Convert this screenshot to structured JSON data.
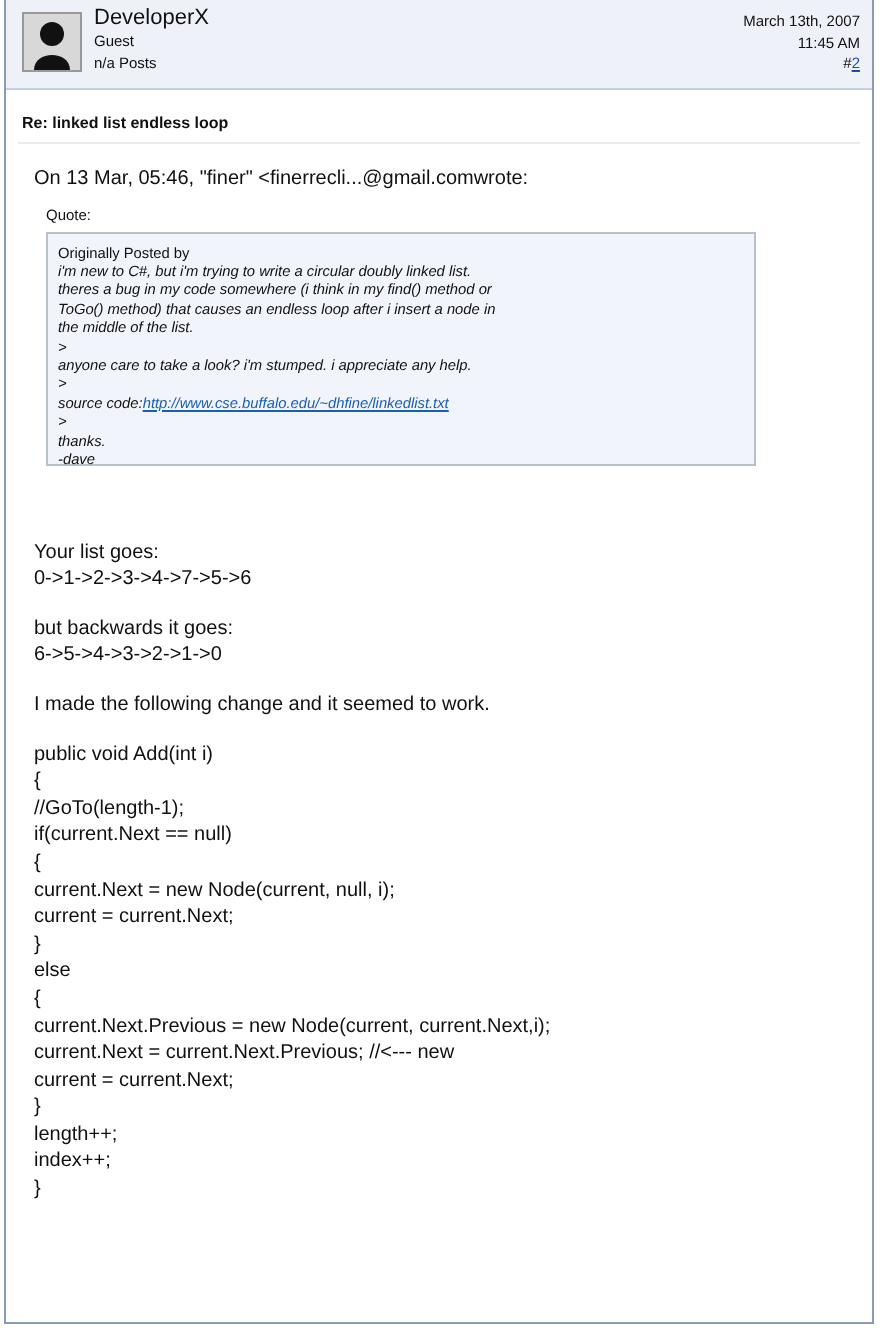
{
  "author": {
    "name": "DeveloperX",
    "rank": "Guest",
    "posts": "n/a Posts"
  },
  "post_date": "March 13th, 2007",
  "post_time": "11:45 AM",
  "post_number": {
    "hash": "#",
    "number": "2"
  },
  "title": "Re: linked list endless loop",
  "intro": "On 13 Mar, 05:46, \"finer\" <finerrecli...@gmail.comwrote:",
  "quote": {
    "label": "Quote:",
    "header": "Originally Posted by",
    "lines": [
      {
        "text": "i'm new to C#, but i'm trying to write a circular doubly linked list."
      },
      {
        "text": "theres a bug in my code somewhere (i think in my find() method or"
      },
      {
        "text": "ToGo() method) that causes an endless loop after i insert a node in"
      },
      {
        "text": "the middle of the list."
      },
      {
        "text": ">"
      },
      {
        "text": "anyone care to take a look? i'm stumped. i appreciate any help."
      },
      {
        "text": ">"
      },
      {
        "text": "source code:",
        "link": "http://www.cse.buffalo.edu/~dhfine/linkedlist.txt"
      },
      {
        "text": ">"
      },
      {
        "text": "thanks."
      },
      {
        "text": "-dave"
      }
    ]
  },
  "paragraphs": [
    [
      "Your list goes:",
      "0->1->2->3->4->7->5->6"
    ],
    [
      "but backwards it goes:",
      "6->5->4->3->2->1->0"
    ],
    [
      "I made the following change and it seemed to work."
    ],
    [
      "public void Add(int i)",
      "{",
      "//GoTo(length-1);",
      "if(current.Next == null)",
      "{",
      "current.Next = new Node(current, null, i);",
      "current = current.Next;",
      "}",
      "else",
      "{",
      "current.Next.Previous = new Node(current, current.Next,i);",
      "current.Next = current.Next.Previous; //<--- new",
      "current = current.Next;",
      "}",
      "length++;",
      "index++;",
      "}"
    ]
  ]
}
